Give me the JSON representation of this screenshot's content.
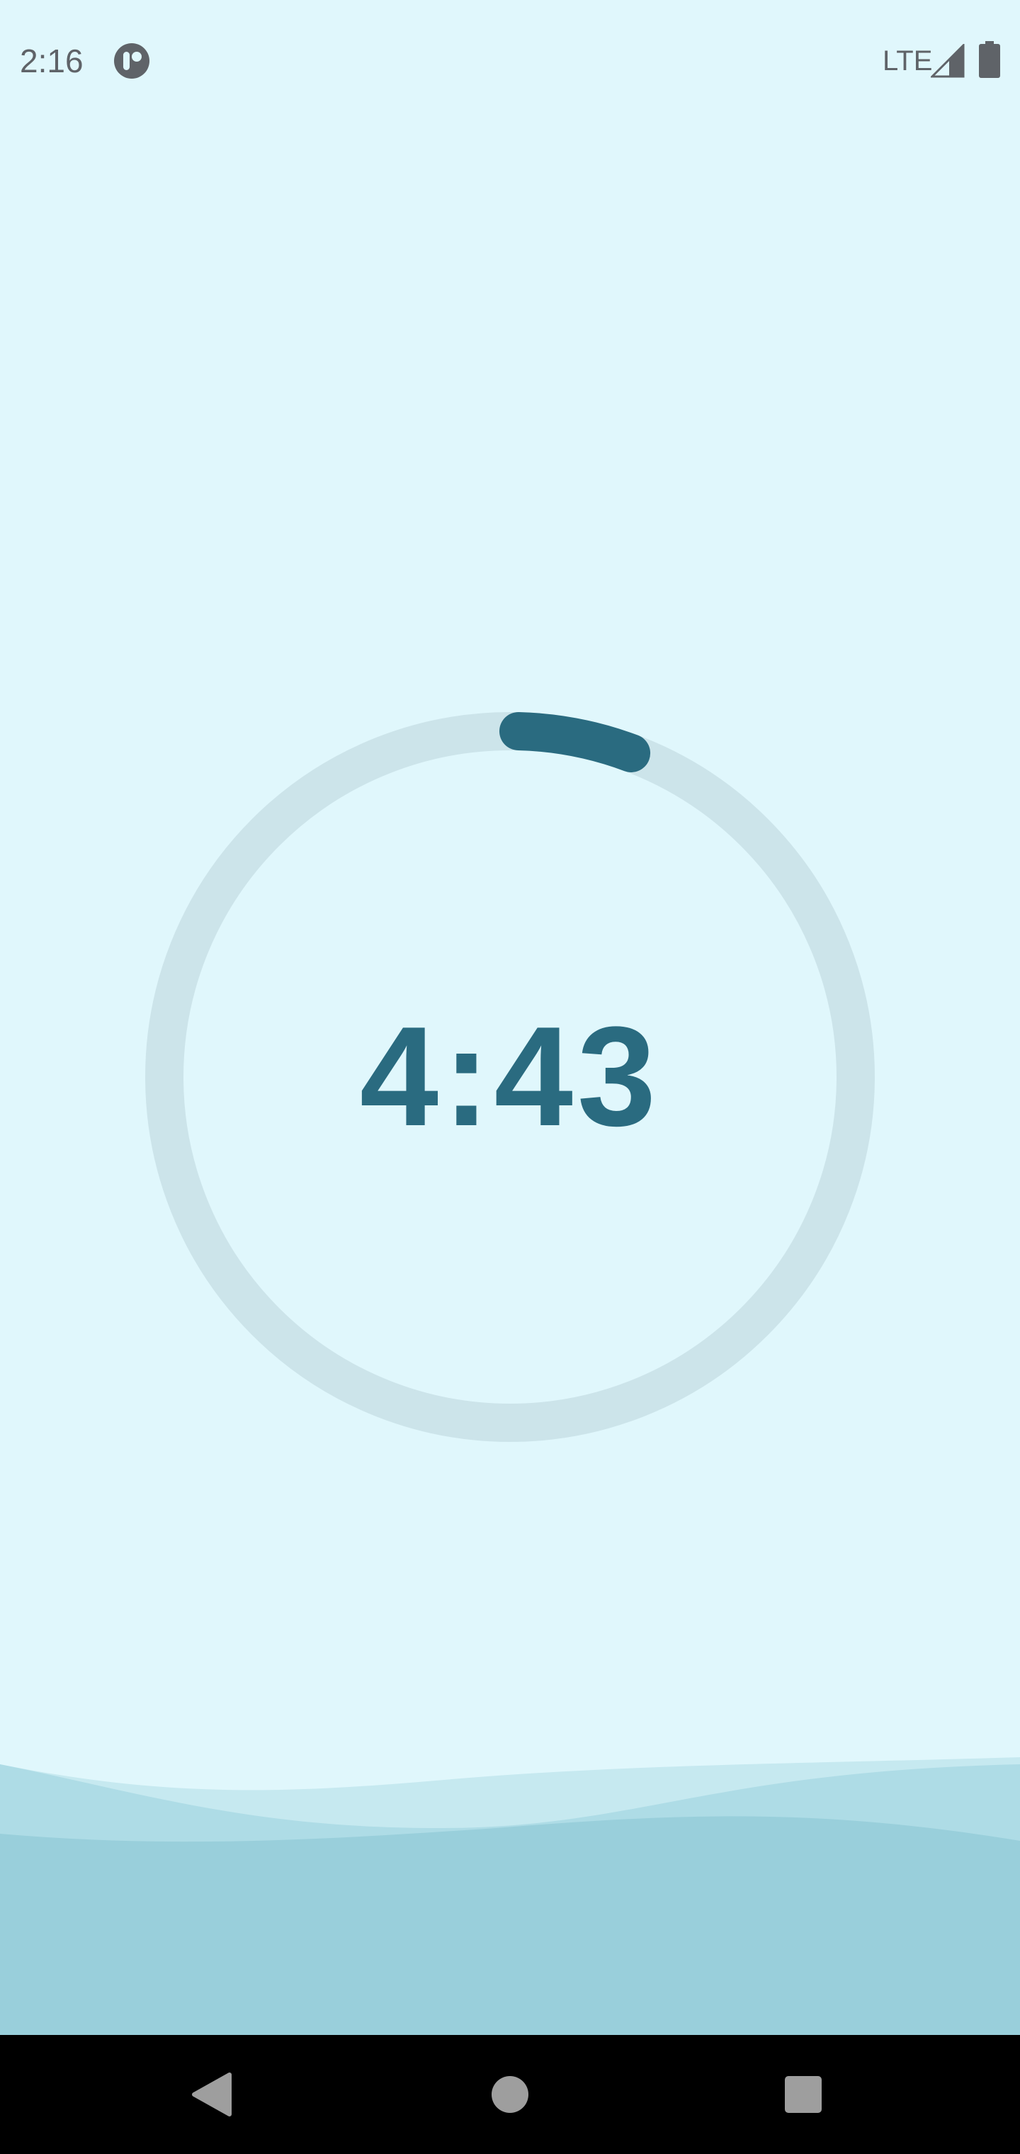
{
  "status_bar": {
    "time": "2:16",
    "network": "LTE",
    "app_icon": "app-notification-icon",
    "signal_icon": "cell-signal-icon",
    "battery_icon": "battery-icon"
  },
  "timer": {
    "remaining": "4:43",
    "progress_fraction": 0.057
  },
  "colors": {
    "background": "#e0f7fc",
    "ring_track": "#cce4ea",
    "ring_progress": "#2a6b80",
    "timer_text": "#2a6b80",
    "wave_light": "#c6e9f0",
    "wave_mid": "#aedce6",
    "wave_dark": "#99cfdb",
    "nav_bar": "#000000"
  },
  "nav_bar": {
    "back_icon": "back-triangle-icon",
    "home_icon": "home-circle-icon",
    "recents_icon": "recents-square-icon"
  }
}
